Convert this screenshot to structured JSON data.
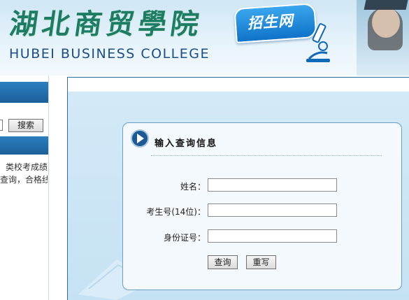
{
  "header": {
    "title_cn": "湖北商贸學院",
    "title_en": "HUBEI BUSINESS COLLEGE",
    "badge": "招生网"
  },
  "sidebar": {
    "search_button": "搜索",
    "text_lines": [
      "类校考成绩",
      "查询，合格线"
    ]
  },
  "form": {
    "title": "输入查询信息",
    "fields": [
      {
        "label": "姓名：",
        "value": ""
      },
      {
        "label": "考生号(14位)：",
        "value": ""
      },
      {
        "label": "身份证号：",
        "value": ""
      }
    ],
    "submit_label": "查询",
    "reset_label": "重写"
  },
  "colors": {
    "brand_green": "#1d7d64",
    "brand_blue": "#1b4f86",
    "nav_blue": "#1b5f99",
    "panel_bg": "#c5e2f4"
  },
  "icons": {
    "badge_icon": "microscope-icon",
    "title_icon": "arrow-right-circle-icon"
  }
}
